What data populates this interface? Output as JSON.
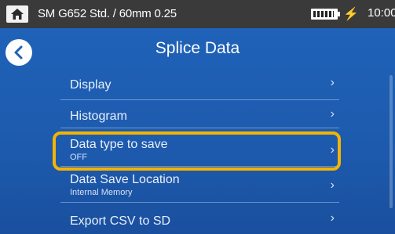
{
  "statusbar": {
    "title": "SM G652 Std. / 60mm 0.25",
    "time": "10:00",
    "charging_symbol": "⚡"
  },
  "header": {
    "title": "Splice Data"
  },
  "menu": {
    "items": [
      {
        "label": "Display",
        "sub": ""
      },
      {
        "label": "Histogram",
        "sub": ""
      },
      {
        "label": "Data type to save",
        "sub": "OFF"
      },
      {
        "label": "Data Save Location",
        "sub": "Internal Memory"
      },
      {
        "label": "Export CSV to SD",
        "sub": ""
      }
    ],
    "chevron": "›"
  },
  "colors": {
    "highlight": "#f5b400",
    "background": "#1f62b8"
  },
  "icons": [
    "home-icon",
    "battery-icon",
    "charging-icon",
    "back-arrow-icon",
    "chevron-right-icon"
  ]
}
